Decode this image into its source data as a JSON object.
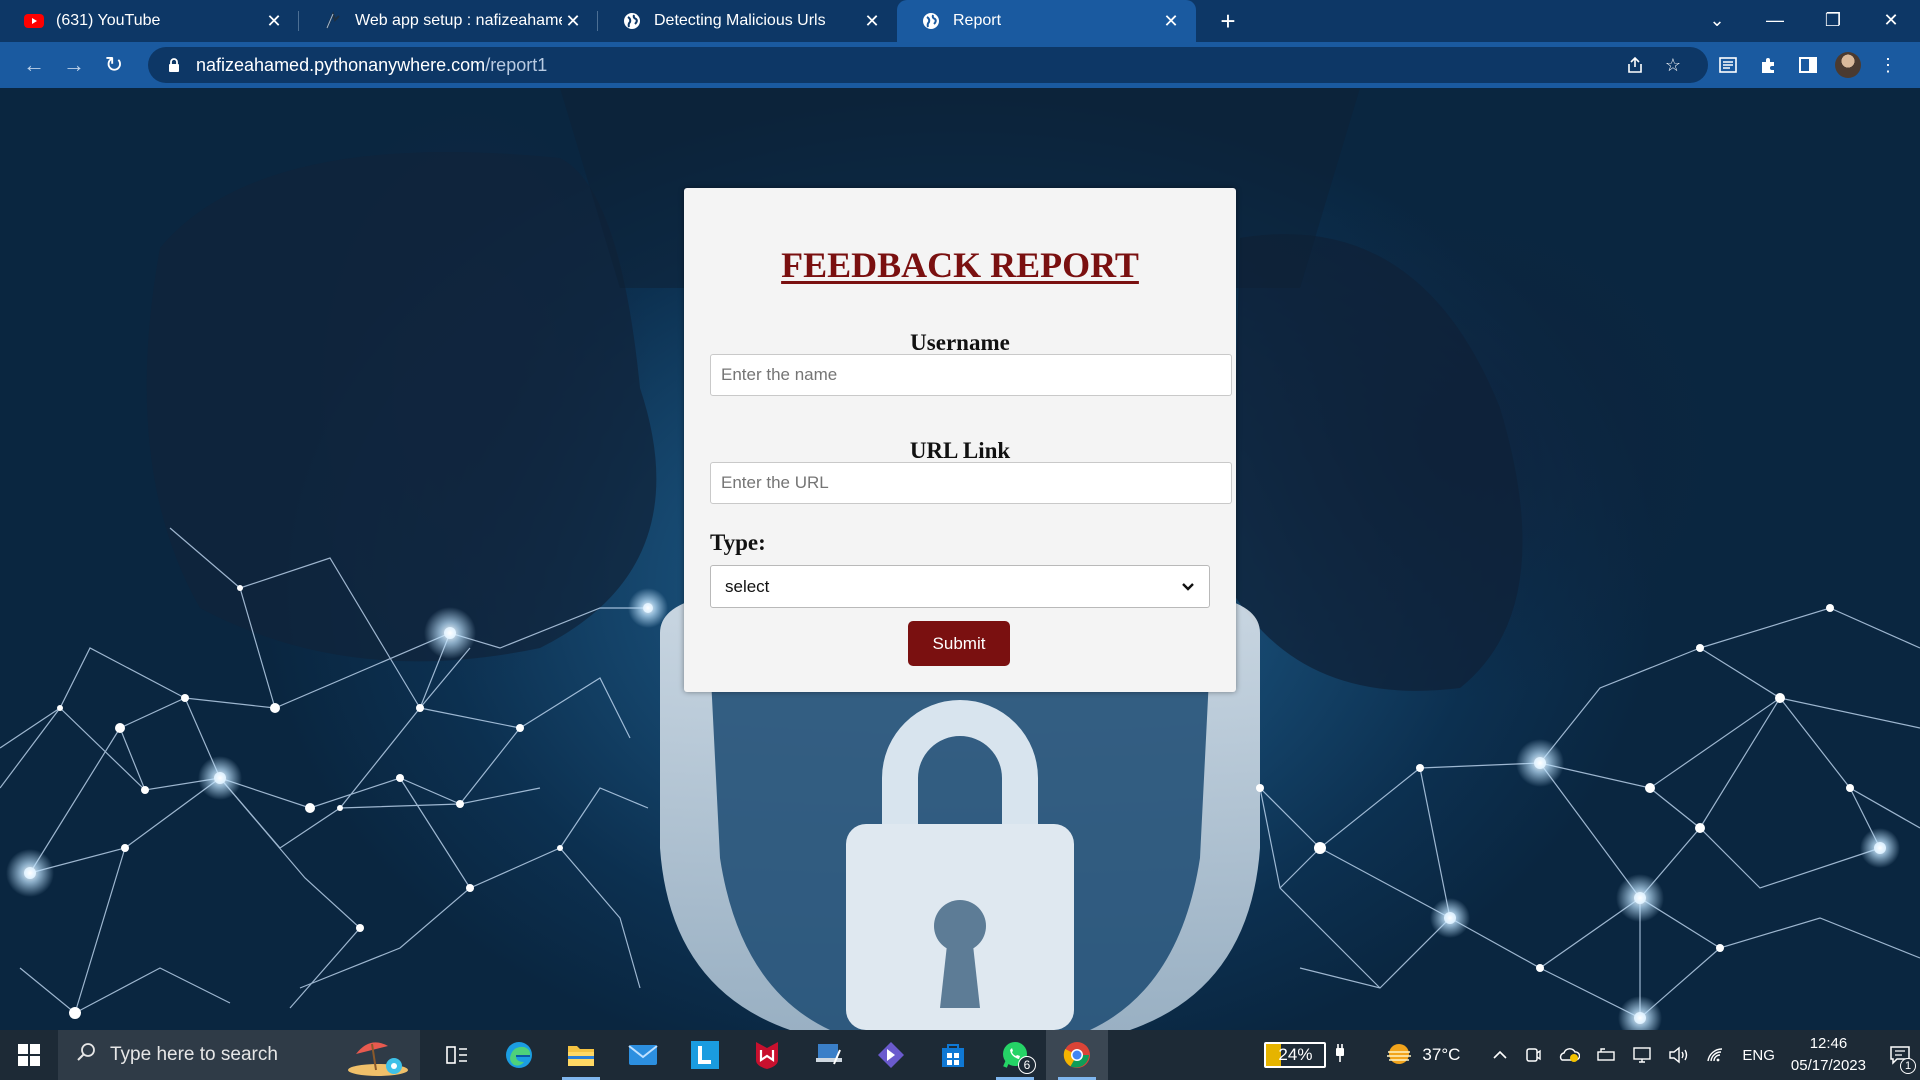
{
  "browser": {
    "tabs": [
      {
        "title": "(631) YouTube",
        "icon": "youtube-icon",
        "active": false
      },
      {
        "title": "Web app setup : nafizeahamed : PythonAnywhere",
        "icon": "pythonanywhere-icon",
        "active": false
      },
      {
        "title": "Detecting Malicious Urls",
        "icon": "globe-icon",
        "active": false
      },
      {
        "title": "Report",
        "icon": "globe-icon",
        "active": true
      }
    ],
    "address": {
      "host": "nafizeahamed.pythonanywhere.com",
      "path": "/report1"
    },
    "colors": {
      "tabstrip": "#0d3766",
      "toolbar": "#1a5aa0"
    }
  },
  "form": {
    "heading": "FEEDBACK REPORT",
    "username_label": "Username",
    "username_placeholder": "Enter the name",
    "url_label": "URL Link",
    "url_placeholder": "Enter the URL",
    "type_label": "Type:",
    "type_selected": "select",
    "submit_label": "Submit",
    "accent_color": "#7a1010"
  },
  "taskbar": {
    "search_placeholder": "Type here to search",
    "whatsapp_badge": "6",
    "battery_percent": "24%",
    "temperature": "37°C",
    "language": "ENG",
    "time": "12:46",
    "date": "05/17/2023",
    "notification_count": "1"
  }
}
